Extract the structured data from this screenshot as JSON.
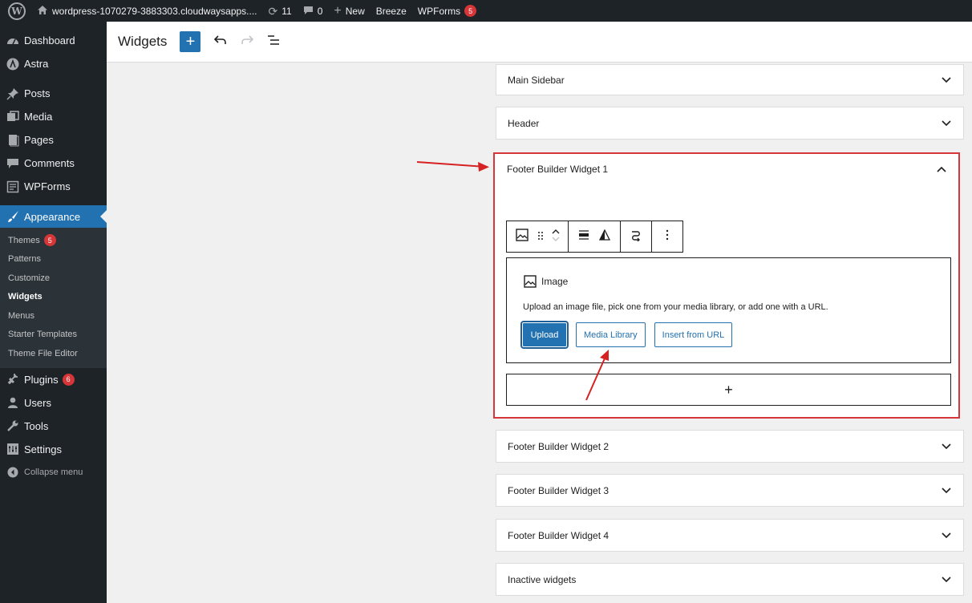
{
  "admin_bar": {
    "site_name": "wordpress-1070279-3883303.cloudwaysapps....",
    "updates_count": "11",
    "comments_count": "0",
    "new_label": "New",
    "breeze_label": "Breeze",
    "wpforms_label": "WPForms",
    "wpforms_badge": "5"
  },
  "sidebar": {
    "items": [
      {
        "label": "Dashboard",
        "icon": "dashboard-icon"
      },
      {
        "label": "Astra",
        "icon": "astra-icon"
      },
      {
        "label": "Posts",
        "icon": "pin-icon"
      },
      {
        "label": "Media",
        "icon": "media-icon"
      },
      {
        "label": "Pages",
        "icon": "pages-icon"
      },
      {
        "label": "Comments",
        "icon": "comment-icon"
      },
      {
        "label": "WPForms",
        "icon": "form-icon"
      },
      {
        "label": "Appearance",
        "icon": "brush-icon"
      }
    ],
    "submenu": [
      {
        "label": "Themes",
        "badge": "5"
      },
      {
        "label": "Patterns"
      },
      {
        "label": "Customize"
      },
      {
        "label": "Widgets"
      },
      {
        "label": "Menus"
      },
      {
        "label": "Starter Templates"
      },
      {
        "label": "Theme File Editor"
      }
    ],
    "items_after": [
      {
        "label": "Plugins",
        "badge": "6",
        "icon": "plugin-icon"
      },
      {
        "label": "Users",
        "icon": "user-icon"
      },
      {
        "label": "Tools",
        "icon": "wrench-icon"
      },
      {
        "label": "Settings",
        "icon": "settings-icon"
      }
    ],
    "collapse_label": "Collapse menu"
  },
  "editor_header": {
    "title": "Widgets",
    "add_symbol": "+"
  },
  "widget_areas": [
    {
      "title": "Main Sidebar"
    },
    {
      "title": "Header"
    },
    {
      "title": "Footer Builder Widget 1"
    },
    {
      "title": "Footer Builder Widget 2"
    },
    {
      "title": "Footer Builder Widget 3"
    },
    {
      "title": "Footer Builder Widget 4"
    },
    {
      "title": "Inactive widgets"
    }
  ],
  "image_block": {
    "title": "Image",
    "instructions": "Upload an image file, pick one from your media library, or add one with a URL.",
    "upload_label": "Upload",
    "media_library_label": "Media Library",
    "insert_url_label": "Insert from URL"
  },
  "appender_symbol": "+",
  "colors": {
    "accent": "#2271b1",
    "highlight": "#d63638",
    "admin_dark": "#1d2327"
  }
}
